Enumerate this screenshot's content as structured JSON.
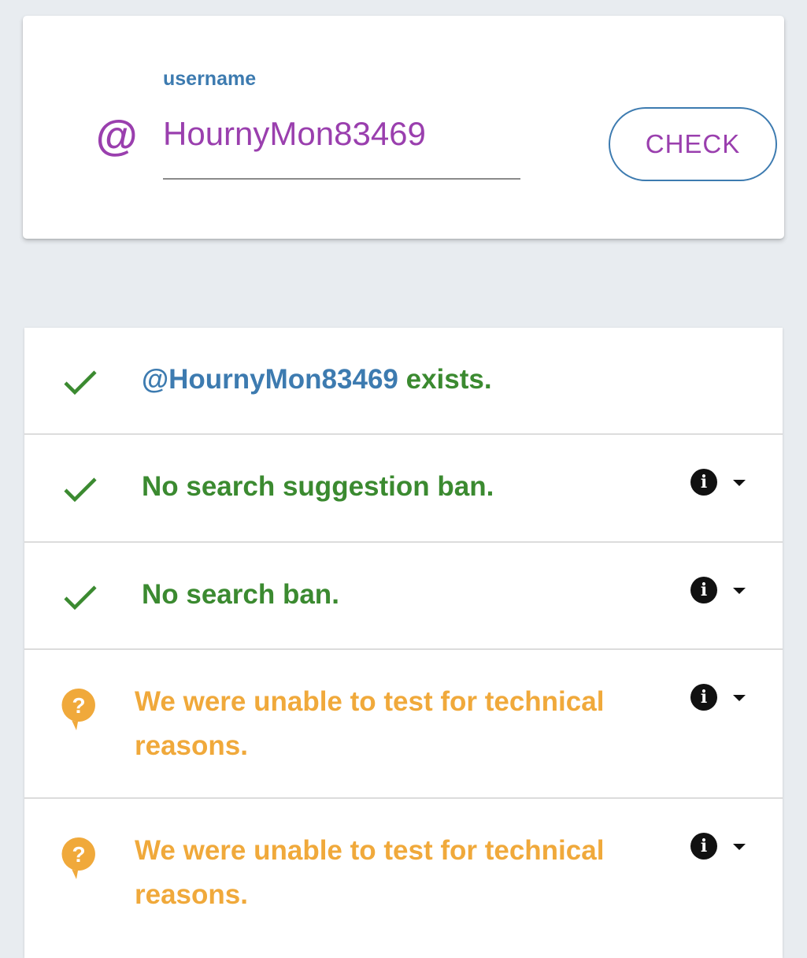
{
  "search": {
    "at_symbol": "@",
    "label": "username",
    "value": "HournyMon83469",
    "button_label": "CHECK"
  },
  "results": [
    {
      "status": "ok",
      "icon": "check-icon",
      "handle": "@HournyMon83469",
      "text": " exists.",
      "has_info": false
    },
    {
      "status": "ok",
      "icon": "check-icon",
      "text": "No search suggestion ban.",
      "has_info": true
    },
    {
      "status": "ok",
      "icon": "check-icon",
      "text": "No search ban.",
      "has_info": true
    },
    {
      "status": "unknown",
      "icon": "question-icon",
      "text": "We were unable to test for technical reasons.",
      "has_info": true
    },
    {
      "status": "unknown",
      "icon": "question-icon",
      "text": "We were unable to test for technical reasons.",
      "has_info": true
    }
  ],
  "colors": {
    "accent_purple": "#9a3fae",
    "accent_blue": "#3d7bb0",
    "ok_green": "#3b8a30",
    "warn_orange": "#f0a93b"
  }
}
